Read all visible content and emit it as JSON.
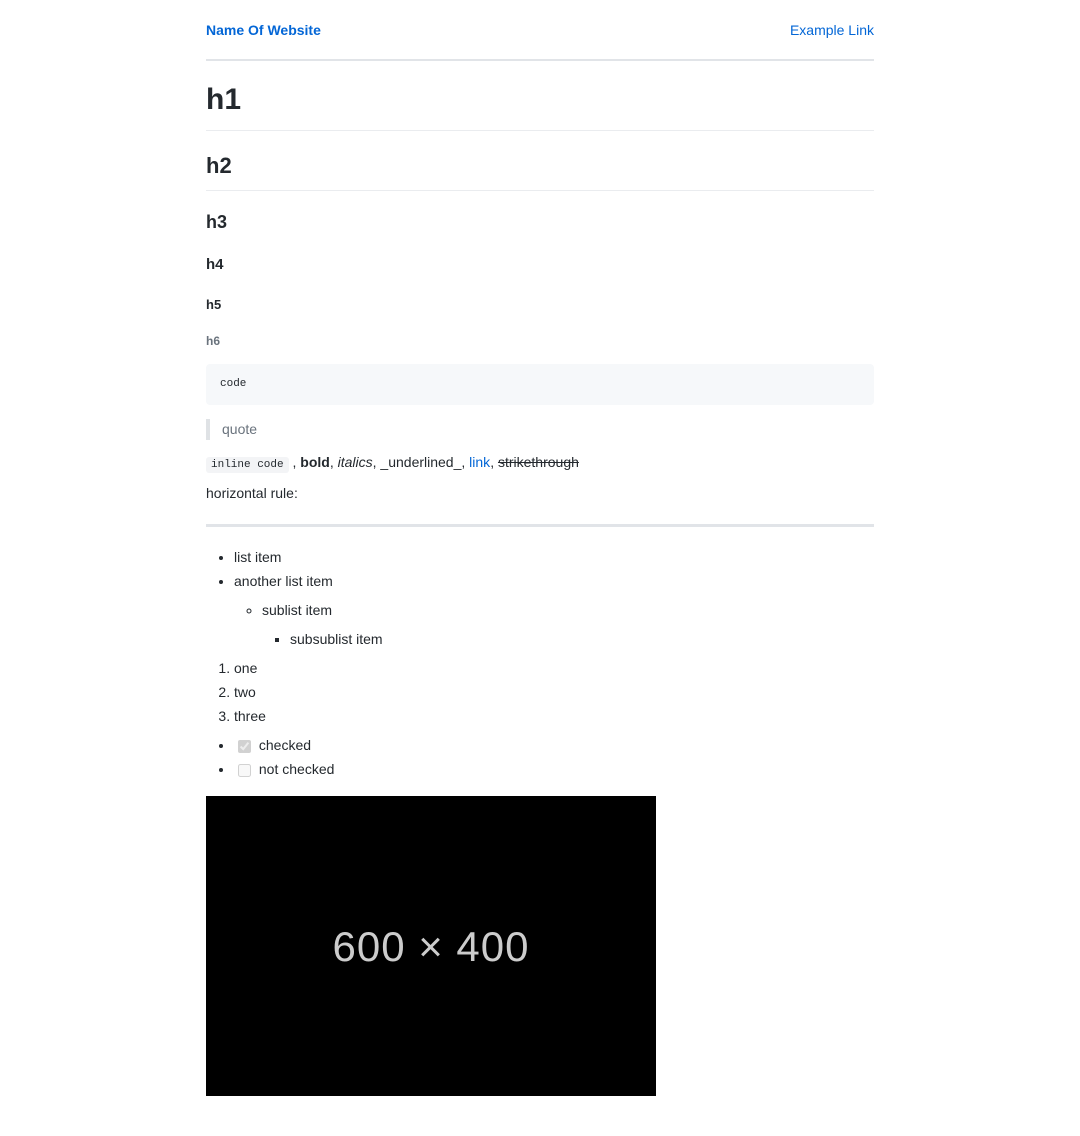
{
  "header": {
    "site_title": "Name Of Website",
    "nav_link": "Example Link"
  },
  "headings": {
    "h1": "h1",
    "h2": "h2",
    "h3": "h3",
    "h4": "h4",
    "h5": "h5",
    "h6": "h6"
  },
  "code_block": "code",
  "blockquote": "quote",
  "inline": {
    "code": "inline code",
    "sep1": " , ",
    "bold": "bold",
    "sep2": ", ",
    "italics": "italics",
    "sep3": ", ",
    "underline": "_underlined_",
    "sep4": ", ",
    "link": "link",
    "sep5": ", ",
    "strike": "strikethrough"
  },
  "hr_label": "horizontal rule:",
  "ulist": {
    "item1": "list item",
    "item2": "another list item",
    "sub1": "sublist item",
    "subsub1": "subsublist item"
  },
  "olist": {
    "one": "one",
    "two": "two",
    "three": "three"
  },
  "tasks": {
    "checked_label": "checked",
    "unchecked_label": "not checked"
  },
  "image": {
    "label": "600 × 400"
  }
}
